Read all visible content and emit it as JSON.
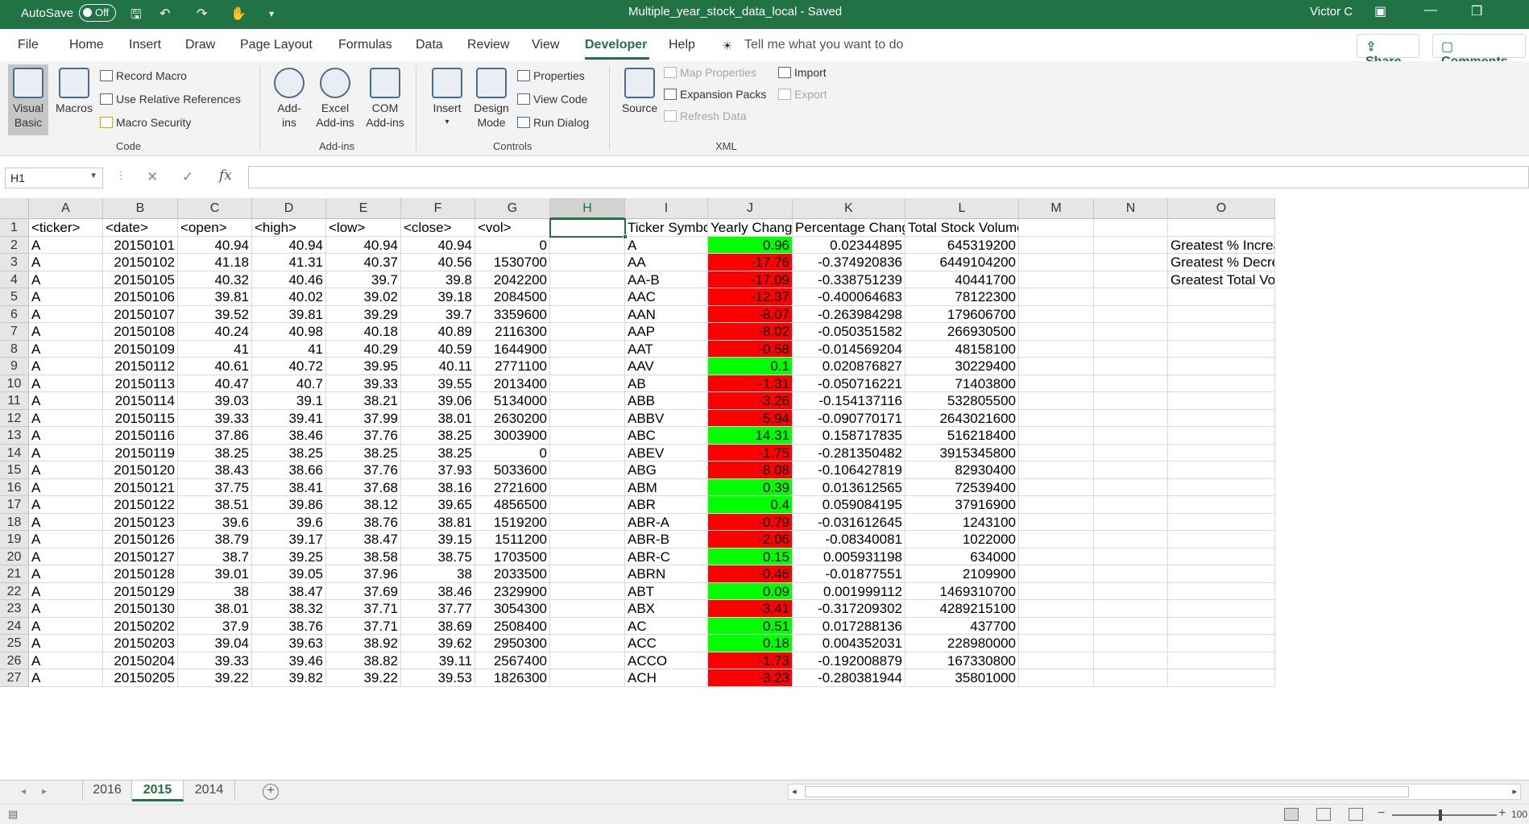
{
  "titlebar": {
    "autosave_label": "AutoSave",
    "autosave_state": "Off",
    "document_title": "Multiple_year_stock_data_local  -  Saved",
    "user_name": "Victor C",
    "color": "#217346"
  },
  "ribbon_tabs": [
    "File",
    "Home",
    "Insert",
    "Draw",
    "Page Layout",
    "Formulas",
    "Data",
    "Review",
    "View",
    "Developer",
    "Help"
  ],
  "active_tab": "Developer",
  "tell_me": "Tell me what you want to do",
  "share_label": "Share",
  "comments_label": "Comments",
  "ribbon": {
    "code": {
      "label": "Code",
      "visual_basic": [
        "Visual",
        "Basic"
      ],
      "macros": "Macros",
      "record_macro": "Record Macro",
      "relative_refs": "Use Relative References",
      "macro_security": "Macro Security"
    },
    "addins": {
      "label": "Add-ins",
      "addins": [
        "Add-",
        "ins"
      ],
      "excel_addins": [
        "Excel",
        "Add-ins"
      ],
      "com_addins": [
        "COM",
        "Add-ins"
      ]
    },
    "controls": {
      "label": "Controls",
      "insert": "Insert",
      "design_mode": [
        "Design",
        "Mode"
      ],
      "properties": "Properties",
      "view_code": "View Code",
      "run_dialog": "Run Dialog"
    },
    "xml": {
      "label": "XML",
      "source": "Source",
      "map_properties": "Map Properties",
      "expansion_packs": "Expansion Packs",
      "refresh_data": "Refresh Data",
      "import": "Import",
      "export": "Export"
    }
  },
  "formula_bar": {
    "name_box": "H1",
    "fx": "fx",
    "value": ""
  },
  "columns": [
    "A",
    "B",
    "C",
    "D",
    "E",
    "F",
    "G",
    "H",
    "I",
    "J",
    "K",
    "L",
    "M",
    "N",
    "O"
  ],
  "selected_cell": "H1",
  "header_row": [
    "<ticker>",
    "<date>",
    "<open>",
    "<high>",
    "<low>",
    "<close>",
    "<vol>",
    "",
    "Ticker Symbol",
    "Yearly Change",
    "Percentage Change",
    "Total Stock Volume",
    "",
    "",
    ""
  ],
  "raw_rows": [
    [
      "A",
      "20150101",
      "40.94",
      "40.94",
      "40.94",
      "40.94",
      "0"
    ],
    [
      "A",
      "20150102",
      "41.18",
      "41.31",
      "40.37",
      "40.56",
      "1530700"
    ],
    [
      "A",
      "20150105",
      "40.32",
      "40.46",
      "39.7",
      "39.8",
      "2042200"
    ],
    [
      "A",
      "20150106",
      "39.81",
      "40.02",
      "39.02",
      "39.18",
      "2084500"
    ],
    [
      "A",
      "20150107",
      "39.52",
      "39.81",
      "39.29",
      "39.7",
      "3359600"
    ],
    [
      "A",
      "20150108",
      "40.24",
      "40.98",
      "40.18",
      "40.89",
      "2116300"
    ],
    [
      "A",
      "20150109",
      "41",
      "41",
      "40.29",
      "40.59",
      "1644900"
    ],
    [
      "A",
      "20150112",
      "40.61",
      "40.72",
      "39.95",
      "40.11",
      "2771100"
    ],
    [
      "A",
      "20150113",
      "40.47",
      "40.7",
      "39.33",
      "39.55",
      "2013400"
    ],
    [
      "A",
      "20150114",
      "39.03",
      "39.1",
      "38.21",
      "39.06",
      "5134000"
    ],
    [
      "A",
      "20150115",
      "39.33",
      "39.41",
      "37.99",
      "38.01",
      "2630200"
    ],
    [
      "A",
      "20150116",
      "37.86",
      "38.46",
      "37.76",
      "38.25",
      "3003900"
    ],
    [
      "A",
      "20150119",
      "38.25",
      "38.25",
      "38.25",
      "38.25",
      "0"
    ],
    [
      "A",
      "20150120",
      "38.43",
      "38.66",
      "37.76",
      "37.93",
      "5033600"
    ],
    [
      "A",
      "20150121",
      "37.75",
      "38.41",
      "37.68",
      "38.16",
      "2721600"
    ],
    [
      "A",
      "20150122",
      "38.51",
      "39.86",
      "38.12",
      "39.65",
      "4856500"
    ],
    [
      "A",
      "20150123",
      "39.6",
      "39.6",
      "38.76",
      "38.81",
      "1519200"
    ],
    [
      "A",
      "20150126",
      "38.79",
      "39.17",
      "38.47",
      "39.15",
      "1511200"
    ],
    [
      "A",
      "20150127",
      "38.7",
      "39.25",
      "38.58",
      "38.75",
      "1703500"
    ],
    [
      "A",
      "20150128",
      "39.01",
      "39.05",
      "37.96",
      "38",
      "2033500"
    ],
    [
      "A",
      "20150129",
      "38",
      "38.47",
      "37.69",
      "38.46",
      "2329900"
    ],
    [
      "A",
      "20150130",
      "38.01",
      "38.32",
      "37.71",
      "37.77",
      "3054300"
    ],
    [
      "A",
      "20150202",
      "37.9",
      "38.76",
      "37.71",
      "38.69",
      "2508400"
    ],
    [
      "A",
      "20150203",
      "39.04",
      "39.63",
      "38.92",
      "39.62",
      "2950300"
    ],
    [
      "A",
      "20150204",
      "39.33",
      "39.46",
      "38.82",
      "39.11",
      "2567400"
    ],
    [
      "A",
      "20150205",
      "39.22",
      "39.82",
      "39.22",
      "39.53",
      "1826300"
    ]
  ],
  "summary_rows": [
    {
      "ticker": "A",
      "change": "0.96",
      "pct": "0.02344895",
      "volume": "645319200",
      "positive": true
    },
    {
      "ticker": "AA",
      "change": "-17.76",
      "pct": "-0.374920836",
      "volume": "6449104200",
      "positive": false
    },
    {
      "ticker": "AA-B",
      "change": "-17.09",
      "pct": "-0.338751239",
      "volume": "40441700",
      "positive": false
    },
    {
      "ticker": "AAC",
      "change": "-12.37",
      "pct": "-0.400064683",
      "volume": "78122300",
      "positive": false
    },
    {
      "ticker": "AAN",
      "change": "-8.07",
      "pct": "-0.263984298",
      "volume": "179606700",
      "positive": false
    },
    {
      "ticker": "AAP",
      "change": "-8.02",
      "pct": "-0.050351582",
      "volume": "266930500",
      "positive": false
    },
    {
      "ticker": "AAT",
      "change": "-0.58",
      "pct": "-0.014569204",
      "volume": "48158100",
      "positive": false
    },
    {
      "ticker": "AAV",
      "change": "0.1",
      "pct": "0.020876827",
      "volume": "30229400",
      "positive": true
    },
    {
      "ticker": "AB",
      "change": "-1.31",
      "pct": "-0.050716221",
      "volume": "71403800",
      "positive": false
    },
    {
      "ticker": "ABB",
      "change": "-3.26",
      "pct": "-0.154137116",
      "volume": "532805500",
      "positive": false
    },
    {
      "ticker": "ABBV",
      "change": "-5.94",
      "pct": "-0.090770171",
      "volume": "2643021600",
      "positive": false
    },
    {
      "ticker": "ABC",
      "change": "14.31",
      "pct": "0.158717835",
      "volume": "516218400",
      "positive": true
    },
    {
      "ticker": "ABEV",
      "change": "-1.75",
      "pct": "-0.281350482",
      "volume": "3915345800",
      "positive": false
    },
    {
      "ticker": "ABG",
      "change": "-8.08",
      "pct": "-0.106427819",
      "volume": "82930400",
      "positive": false
    },
    {
      "ticker": "ABM",
      "change": "0.39",
      "pct": "0.013612565",
      "volume": "72539400",
      "positive": true
    },
    {
      "ticker": "ABR",
      "change": "0.4",
      "pct": "0.059084195",
      "volume": "37916900",
      "positive": true
    },
    {
      "ticker": "ABR-A",
      "change": "-0.79",
      "pct": "-0.031612645",
      "volume": "1243100",
      "positive": false
    },
    {
      "ticker": "ABR-B",
      "change": "-2.06",
      "pct": "-0.08340081",
      "volume": "1022000",
      "positive": false
    },
    {
      "ticker": "ABR-C",
      "change": "0.15",
      "pct": "0.005931198",
      "volume": "634000",
      "positive": true
    },
    {
      "ticker": "ABRN",
      "change": "-0.46",
      "pct": "-0.01877551",
      "volume": "2109900",
      "positive": false
    },
    {
      "ticker": "ABT",
      "change": "0.09",
      "pct": "0.001999112",
      "volume": "1469310700",
      "positive": true
    },
    {
      "ticker": "ABX",
      "change": "-3.41",
      "pct": "-0.317209302",
      "volume": "4289215100",
      "positive": false
    },
    {
      "ticker": "AC",
      "change": "0.51",
      "pct": "0.017288136",
      "volume": "437700",
      "positive": true
    },
    {
      "ticker": "ACC",
      "change": "0.18",
      "pct": "0.004352031",
      "volume": "228980000",
      "positive": true
    },
    {
      "ticker": "ACCO",
      "change": "-1.73",
      "pct": "-0.192008879",
      "volume": "167330800",
      "positive": false
    },
    {
      "ticker": "ACH",
      "change": "-3.23",
      "pct": "-0.280381944",
      "volume": "35801000",
      "positive": false
    }
  ],
  "greatest_labels": [
    "Greatest % Increa",
    "Greatest % Decre",
    "Greatest Total Vo"
  ],
  "positive_color": "#00ff00",
  "negative_color": "#ff0000",
  "sheet_tabs": [
    "2016",
    "2015",
    "2014"
  ],
  "active_sheet": "2015",
  "zoom_text": "100"
}
